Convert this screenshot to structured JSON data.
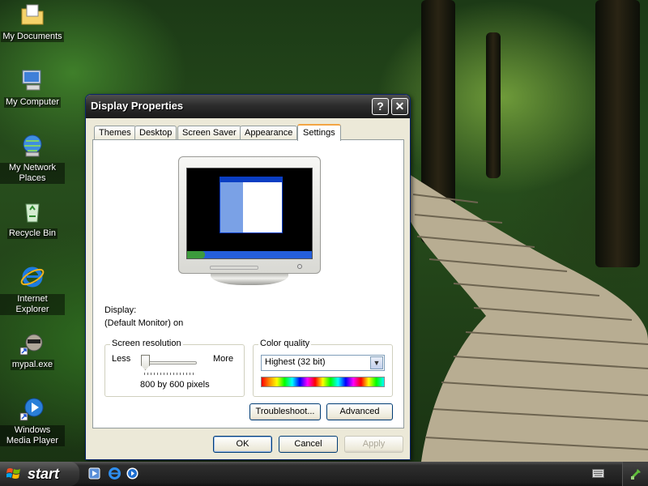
{
  "desktop": {
    "icons": [
      {
        "label": "My Documents",
        "icon": "folder-documents-icon"
      },
      {
        "label": "My Computer",
        "icon": "computer-icon"
      },
      {
        "label": "My Network Places",
        "icon": "network-places-icon"
      },
      {
        "label": "Recycle Bin",
        "icon": "recycle-bin-icon"
      },
      {
        "label": "Internet Explorer",
        "icon": "internet-explorer-icon"
      },
      {
        "label": "mypal.exe",
        "icon": "mypal-raccoon-icon"
      },
      {
        "label": "Windows Media Player",
        "icon": "media-player-icon"
      }
    ]
  },
  "window": {
    "title": "Display Properties",
    "help_glyph": "?",
    "close_glyph": "✕",
    "tabs": [
      "Themes",
      "Desktop",
      "Screen Saver",
      "Appearance",
      "Settings"
    ],
    "active_tab": "Settings",
    "display_label": "Display:",
    "display_value": "(Default Monitor) on",
    "resolution": {
      "legend": "Screen resolution",
      "less": "Less",
      "more": "More",
      "value_text": "800 by 600 pixels",
      "slider_level": 0
    },
    "color_quality": {
      "legend": "Color quality",
      "selected": "Highest (32 bit)"
    },
    "buttons": {
      "troubleshoot": "Troubleshoot...",
      "advanced": "Advanced",
      "ok": "OK",
      "cancel": "Cancel",
      "apply": "Apply"
    }
  },
  "taskbar": {
    "start_label": "start",
    "quick_launch": [
      "media-icon",
      "internet-explorer-icon",
      "media-player-icon"
    ],
    "tray_icons": [
      "keyboard-icon",
      "safely-remove-icon"
    ]
  },
  "colors": {
    "title_bar": "#2c2c2c",
    "active_tab_accent": "#f3a544",
    "taskbar": "#1e1e1e"
  }
}
